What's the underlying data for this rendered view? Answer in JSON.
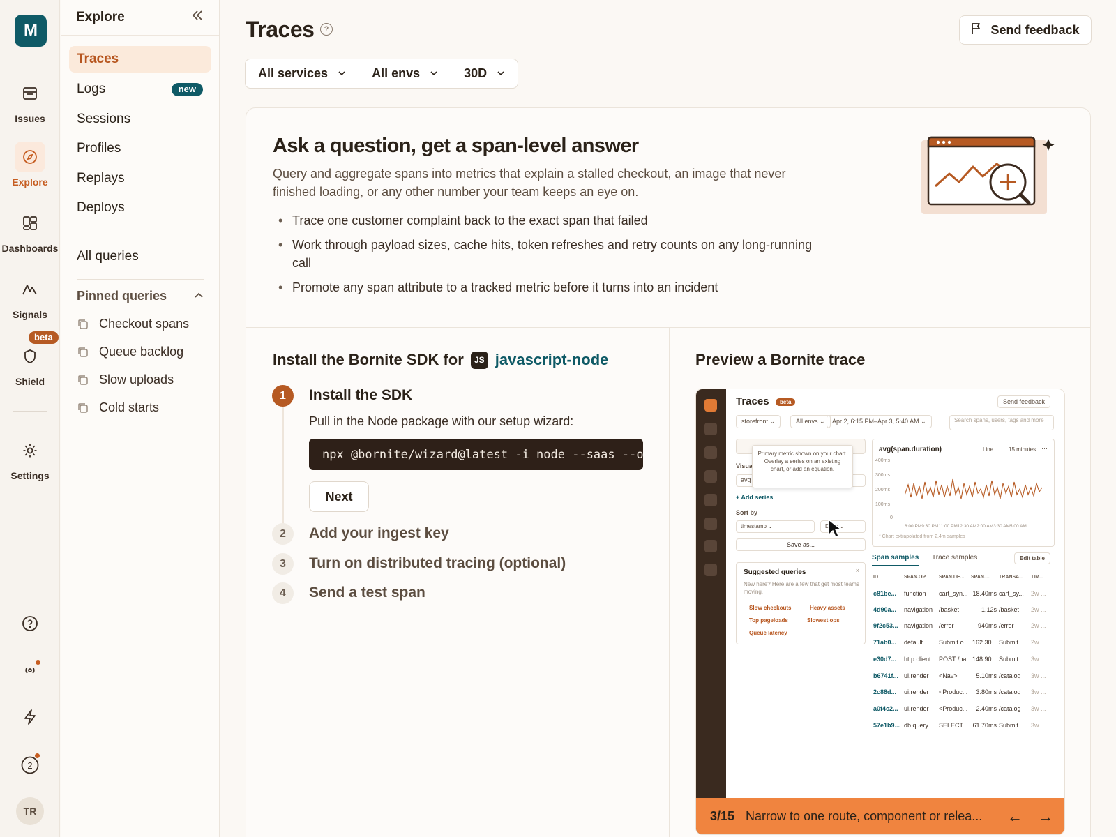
{
  "rail": {
    "org_initial": "M",
    "items": [
      {
        "label": "Issues",
        "icon": "inbox-icon"
      },
      {
        "label": "Explore",
        "icon": "compass-icon"
      },
      {
        "label": "Dashboards",
        "icon": "dashboard-icon"
      },
      {
        "label": "Signals",
        "icon": "signal-icon"
      },
      {
        "label": "Shield",
        "icon": "shield-icon"
      },
      {
        "label": "Settings",
        "icon": "gear-icon"
      }
    ],
    "shield_badge": "beta",
    "onboarding_count": "2",
    "avatar_initials": "TR"
  },
  "subnav": {
    "title": "Explore",
    "items": [
      {
        "label": "Traces"
      },
      {
        "label": "Logs",
        "badge": "new"
      },
      {
        "label": "Sessions"
      },
      {
        "label": "Profiles"
      },
      {
        "label": "Replays"
      },
      {
        "label": "Deploys"
      }
    ],
    "all_queries": "All queries",
    "pinned_title": "Pinned queries",
    "pinned": [
      "Checkout spans",
      "Queue backlog",
      "Slow uploads",
      "Cold starts"
    ]
  },
  "header": {
    "title": "Traces",
    "feedback_label": "Send feedback",
    "filters": [
      "All services",
      "All envs",
      "30D"
    ]
  },
  "hero": {
    "title": "Ask a question, get a span-level answer",
    "description": "Query and aggregate spans into metrics that explain a stalled checkout, an image that never finished loading, or any other number your team keeps an eye on.",
    "bullets": [
      "Trace one customer complaint back to the exact span that failed",
      "Work through payload sizes, cache hits, token refreshes and retry counts on any long-running call",
      "Promote any span attribute to a tracked metric before it turns into an incident"
    ]
  },
  "install": {
    "title_prefix": "Install the Bornite SDK for",
    "platform_badge": "JS",
    "platform": "javascript-node",
    "steps": [
      {
        "num": "1",
        "title": "Install the SDK"
      },
      {
        "num": "2",
        "title": "Add your ingest key"
      },
      {
        "num": "3",
        "title": "Turn on distributed tracing (optional)"
      },
      {
        "num": "4",
        "title": "Send a test span"
      }
    ],
    "step1_desc": "Pull in the Node package with our setup wizard:",
    "command": "npx @bornite/wizard@latest -i node --saas --o",
    "next_label": "Next"
  },
  "preview": {
    "title": "Preview a Bornite trace",
    "mock": {
      "title": "Traces",
      "badge": "beta",
      "feedback": "Send feedback",
      "filters": [
        "storefront ⌄",
        "All envs ⌄",
        "Apr 2, 6:15 PM–Apr 3, 5:40 AM ⌄"
      ],
      "search": "Search spans, users, tags and more",
      "tooltip": "Primary metric shown on your chart. Overlay a series on an existing chart, or add an equation.",
      "visualize": "Visua",
      "avg": "avg",
      "add_series": "+ Add series",
      "sort_by": "Sort by",
      "sort_field": "timestamp ⌄",
      "sort_dir": "Desc ⌄",
      "save_as": "Save as...",
      "suggested_title": "Suggested queries",
      "suggested_desc": "New here? Here are a few that get most teams moving.",
      "chips": [
        "Slow checkouts",
        "Heavy assets",
        "Top pageloads",
        "Slowest ops",
        "Queue latency"
      ],
      "chart_title": "avg(span.duration)",
      "chart_type": "Line",
      "chart_interval": "15 minutes",
      "y_ticks": [
        "400ms",
        "300ms",
        "200ms",
        "100ms",
        "0"
      ],
      "x_ticks": "8:00 PM9:30 PM11:00 PM12:30 AM2:00 AM3:30 AM5:00 AM",
      "extrapolated": "* Chart extrapolated from 2.4m samples",
      "tab_spans": "Span samples",
      "tab_traces": "Trace samples",
      "edit_table": "Edit table",
      "columns": [
        "ID",
        "SPAN.OP",
        "SPAN.DE...",
        "SPAN....",
        "TRANSA...",
        "TIM..."
      ],
      "rows": [
        [
          "c81be...",
          "function",
          "cart_syn...",
          "18.40ms",
          "cart_sy...",
          "2w ..."
        ],
        [
          "4d90a...",
          "navigation",
          "/basket",
          "1.12s",
          "/basket",
          "2w ..."
        ],
        [
          "9f2c53...",
          "navigation",
          "/error",
          "940ms",
          "/error",
          "2w ..."
        ],
        [
          "71ab0...",
          "default",
          "Submit o...",
          "162.30...",
          "Submit ...",
          "2w ..."
        ],
        [
          "e30d7...",
          "http.client",
          "POST /pa...",
          "148.90...",
          "Submit ...",
          "3w ..."
        ],
        [
          "b6741f...",
          "ui.render",
          "<Nav>",
          "5.10ms",
          "/catalog",
          "3w ..."
        ],
        [
          "2c88d...",
          "ui.render",
          "<Produc...",
          "3.80ms",
          "/catalog",
          "3w ..."
        ],
        [
          "a0f4c2...",
          "ui.render",
          "<Produc...",
          "2.40ms",
          "/catalog",
          "3w ..."
        ],
        [
          "57e1b9...",
          "db.query",
          "SELECT ...",
          "61.70ms",
          "Submit ...",
          "3w ..."
        ]
      ]
    },
    "banner_step": "3/15",
    "banner_text": "Narrow to one route, component or relea..."
  }
}
